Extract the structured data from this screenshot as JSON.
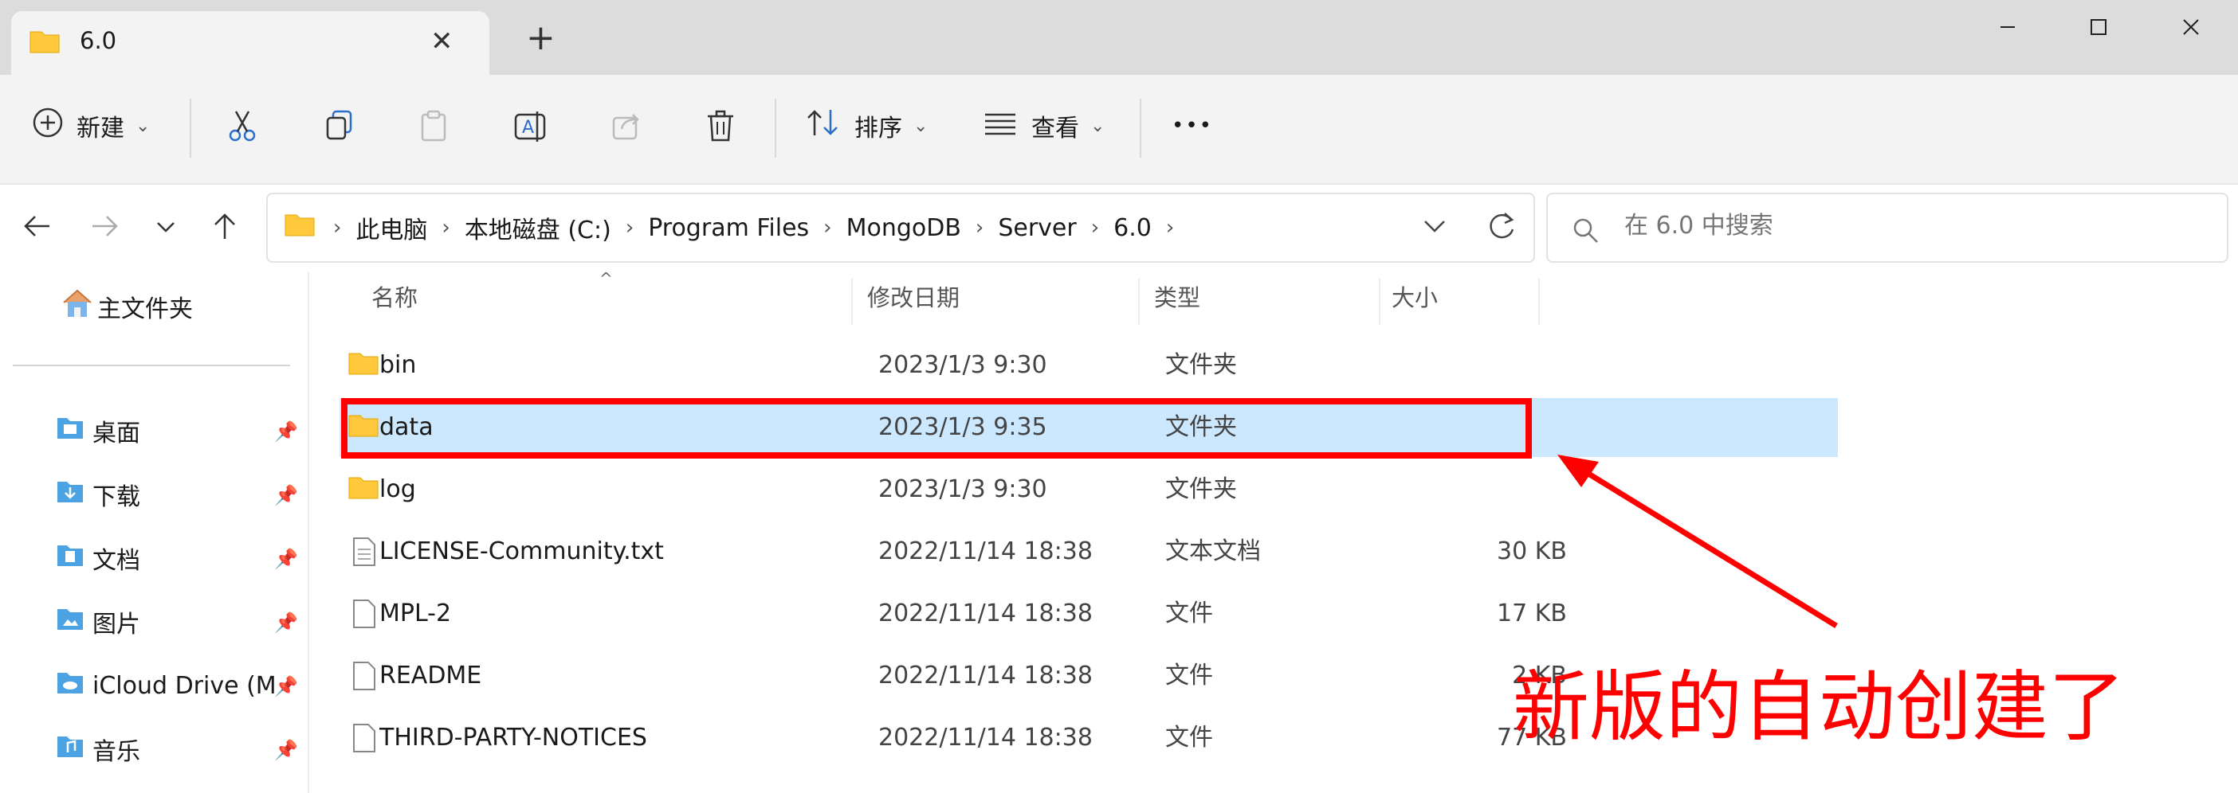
{
  "window": {
    "tab_title": "6.0",
    "new_tab_glyph": "+",
    "close_tab_glyph": "✕"
  },
  "toolbar": {
    "new_label": "新建",
    "sort_label": "排序",
    "view_label": "查看",
    "more_glyph": "•••"
  },
  "nav": {
    "breadcrumbs": [
      "此电脑",
      "本地磁盘 (C:)",
      "Program Files",
      "MongoDB",
      "Server",
      "6.0"
    ],
    "search_placeholder": "在 6.0 中搜索"
  },
  "sidebar": {
    "home": "主文件夹",
    "items": [
      {
        "label": "桌面",
        "icon": "desktop-folder-icon"
      },
      {
        "label": "下载",
        "icon": "downloads-folder-icon"
      },
      {
        "label": "文档",
        "icon": "documents-folder-icon"
      },
      {
        "label": "图片",
        "icon": "pictures-folder-icon"
      },
      {
        "label": "iCloud Drive (M",
        "icon": "icloud-folder-icon"
      },
      {
        "label": "音乐",
        "icon": "music-folder-icon"
      }
    ]
  },
  "columns": {
    "name": "名称",
    "date": "修改日期",
    "type": "类型",
    "size": "大小"
  },
  "files": [
    {
      "name": "bin",
      "date": "2023/1/3 9:30",
      "type": "文件夹",
      "size": "",
      "kind": "folder",
      "selected": false
    },
    {
      "name": "data",
      "date": "2023/1/3 9:35",
      "type": "文件夹",
      "size": "",
      "kind": "folder",
      "selected": true
    },
    {
      "name": "log",
      "date": "2023/1/3 9:30",
      "type": "文件夹",
      "size": "",
      "kind": "folder",
      "selected": false
    },
    {
      "name": "LICENSE-Community.txt",
      "date": "2022/11/14 18:38",
      "type": "文本文档",
      "size": "30 KB",
      "kind": "text",
      "selected": false
    },
    {
      "name": "MPL-2",
      "date": "2022/11/14 18:38",
      "type": "文件",
      "size": "17 KB",
      "kind": "file",
      "selected": false
    },
    {
      "name": "README",
      "date": "2022/11/14 18:38",
      "type": "文件",
      "size": "2 KB",
      "kind": "file",
      "selected": false
    },
    {
      "name": "THIRD-PARTY-NOTICES",
      "date": "2022/11/14 18:38",
      "type": "文件",
      "size": "77 KB",
      "kind": "file",
      "selected": false
    }
  ],
  "annotation": {
    "text": "新版的自动创建了",
    "color": "#ff0000"
  },
  "colors": {
    "accent_selected": "#cce8ff",
    "folder_yellow": "#ffc83d"
  }
}
